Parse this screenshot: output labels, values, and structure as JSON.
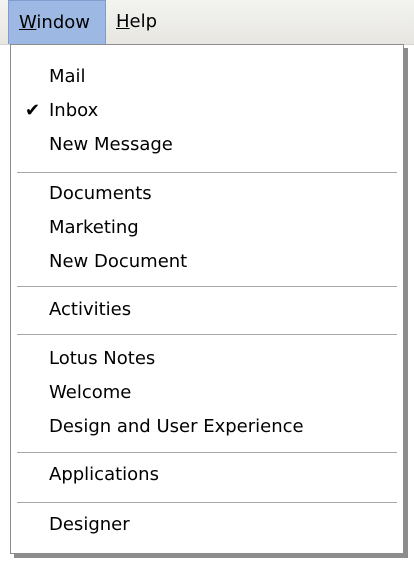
{
  "menubar": {
    "window_label_first": "W",
    "window_label_rest": "indow",
    "help_label_first": "H",
    "help_label_rest": "elp"
  },
  "menu": {
    "groups": [
      {
        "items": [
          {
            "label": "Mail",
            "checked": false
          },
          {
            "label": "Inbox",
            "checked": true
          },
          {
            "label": "New Message",
            "checked": false
          }
        ]
      },
      {
        "items": [
          {
            "label": "Documents",
            "checked": false
          },
          {
            "label": "Marketing",
            "checked": false
          },
          {
            "label": "New Document",
            "checked": false
          }
        ]
      },
      {
        "items": [
          {
            "label": "Activities",
            "checked": false
          }
        ]
      },
      {
        "items": [
          {
            "label": "Lotus Notes",
            "checked": false
          },
          {
            "label": "Welcome",
            "checked": false
          },
          {
            "label": "Design and User Experience",
            "checked": false
          }
        ]
      },
      {
        "items": [
          {
            "label": "Applications",
            "checked": false
          }
        ]
      },
      {
        "items": [
          {
            "label": "Designer",
            "checked": false
          }
        ]
      }
    ],
    "check_glyph": "✔"
  }
}
